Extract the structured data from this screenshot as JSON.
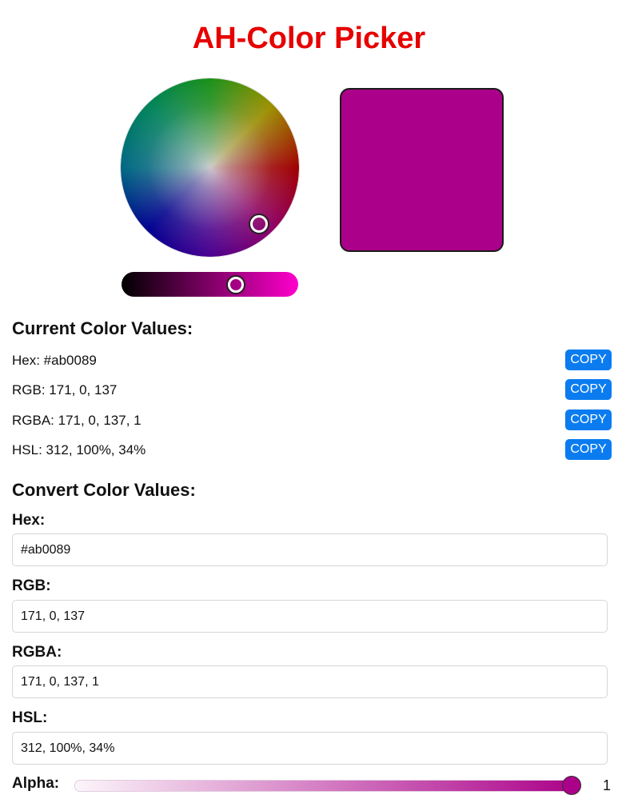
{
  "app": {
    "title": "AH-Color Picker"
  },
  "current_color": {
    "hex": "#ab0089"
  },
  "picker": {
    "brightness_fraction": 0.65
  },
  "current_values": {
    "heading": "Current Color Values:",
    "copy_label": "COPY",
    "rows": [
      {
        "text": "Hex: #ab0089"
      },
      {
        "text": "RGB: 171, 0, 137"
      },
      {
        "text": "RGBA: 171, 0, 137, 1"
      },
      {
        "text": "HSL: 312, 100%, 34%"
      }
    ]
  },
  "convert": {
    "heading": "Convert Color Values:",
    "fields": [
      {
        "label": "Hex:",
        "value": "#ab0089"
      },
      {
        "label": "RGB:",
        "value": "171, 0, 137"
      },
      {
        "label": "RGBA:",
        "value": "171, 0, 137, 1"
      },
      {
        "label": "HSL:",
        "value": "312, 100%, 34%"
      }
    ]
  },
  "alpha": {
    "label": "Alpha:",
    "value": "1"
  },
  "colors": {
    "title": "#e60000",
    "copy_button": "#0a7cf0"
  }
}
